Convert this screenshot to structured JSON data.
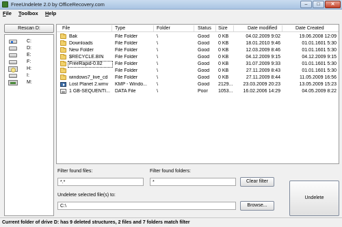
{
  "window": {
    "title": "FreeUndelete 2.0 by OfficeRecovery.com",
    "minimize": "–",
    "maximize": "□",
    "close": "✕"
  },
  "menu": [
    {
      "label": "File",
      "underline": "F",
      "rest": "ile"
    },
    {
      "label": "Toolbox",
      "underline": "T",
      "rest": "oolbox"
    },
    {
      "label": "Help",
      "underline": "H",
      "rest": "elp"
    }
  ],
  "left_panel": {
    "rescan_label": "Rescan D:",
    "drives": [
      {
        "label": "C:",
        "icon": "system-drive-icon"
      },
      {
        "label": "D:",
        "icon": "hard-drive-icon"
      },
      {
        "label": "E:",
        "icon": "hard-drive-icon"
      },
      {
        "label": "F:",
        "icon": "hard-drive-icon"
      },
      {
        "label": "H:",
        "icon": "cdrom-drive-icon"
      },
      {
        "label": "I:",
        "icon": "hard-drive-icon"
      },
      {
        "label": "M:",
        "icon": "memory-card-icon"
      }
    ]
  },
  "file_list": {
    "columns": [
      "File",
      "Type",
      "Folder",
      "Status",
      "Size",
      "Date modified",
      "Date Created"
    ],
    "rows": [
      {
        "icon": "folder-icon",
        "file": "Bak",
        "type": "File Folder",
        "folder": "\\",
        "status": "Good",
        "size": "0 KB",
        "modified": "04.02.2009  9:02",
        "created": "19.06.2008 12:09"
      },
      {
        "icon": "folder-icon",
        "file": "Downloads",
        "type": "File Folder",
        "folder": "\\",
        "status": "Good",
        "size": "0 KB",
        "modified": "18.01.2010  9:46",
        "created": "01.01.1601  5:30"
      },
      {
        "icon": "folder-icon",
        "file": "New Folder",
        "type": "File Folder",
        "folder": "\\",
        "status": "Good",
        "size": "0 KB",
        "modified": "12.03.2009  8:46",
        "created": "01.01.1601  5:30"
      },
      {
        "icon": "folder-icon",
        "file": "$RECYCLE.BIN",
        "type": "File Folder",
        "folder": "\\",
        "status": "Good",
        "size": "0 KB",
        "modified": "04.12.2009  9:15",
        "created": "04.12.2009  9:15"
      },
      {
        "icon": "folder-icon",
        "file": "FreeRapid-0.82",
        "type": "File Folder",
        "folder": "\\",
        "status": "Good",
        "size": "0 KB",
        "modified": "31.07.2009  9:33",
        "created": "01.01.1601  5:30"
      },
      {
        "icon": "folder-icon",
        "file": "",
        "type": "File Folder",
        "folder": "\\",
        "status": "Good",
        "size": "0 KB",
        "modified": "27.11.2009  8:43",
        "created": "01.01.1601  5:30"
      },
      {
        "icon": "folder-icon",
        "file": "windows7_live_cd",
        "type": "File Folder",
        "folder": "\\",
        "status": "Good",
        "size": "0 KB",
        "modified": "27.11.2009  8:44",
        "created": "11.05.2009 16:56"
      },
      {
        "icon": "video-icon",
        "file": "Lost Planet 2.wmv",
        "type": "KMP - Windo...",
        "folder": "\\",
        "status": "Good",
        "size": "2129...",
        "modified": "23.03.2009 20:23",
        "created": "13.05.2009 15:23"
      },
      {
        "icon": "data-icon",
        "file": "1 GB-SEQUENTI...",
        "type": "DATA File",
        "folder": "\\",
        "status": "Poor",
        "size": "1053...",
        "modified": "16.02.2006 14:29",
        "created": "04.05.2009  8:22"
      }
    ]
  },
  "filters": {
    "files_label": "Filter found files:",
    "files_value": "*.*",
    "folders_label": "Filter found folders:",
    "folders_value": "*",
    "clear_label": "Clear filter"
  },
  "destination": {
    "label": "Undelete selected file(s) to:",
    "value": "C:\\",
    "browse_label": "Browse..."
  },
  "undelete_label": "Undelete",
  "status": "Current folder of drive D: has 9 deleted structures, 2 files and 7 folders match filter"
}
